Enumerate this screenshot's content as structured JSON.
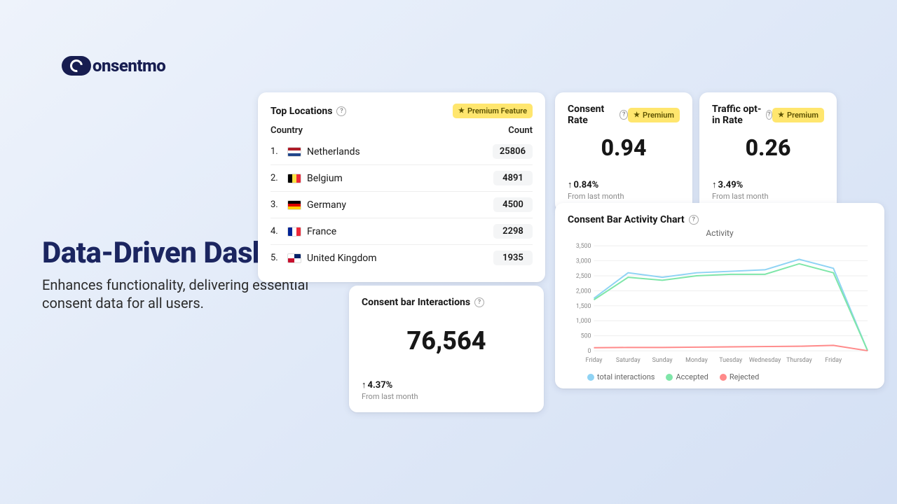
{
  "brand": {
    "name": "onsentmo"
  },
  "hero": {
    "title": "Data-Driven Dashboard",
    "subtitle": "Enhances functionality, delivering essential consent data for all users."
  },
  "badges": {
    "premium_feature": "Premium Feature",
    "premium": "Premium"
  },
  "top_locations": {
    "title": "Top Locations",
    "columns": {
      "country": "Country",
      "count": "Count"
    },
    "rows": [
      {
        "rank": "1.",
        "name": "Netherlands",
        "count": "25806",
        "flag": "nl"
      },
      {
        "rank": "2.",
        "name": "Belgium",
        "count": "4891",
        "flag": "be"
      },
      {
        "rank": "3.",
        "name": "Germany",
        "count": "4500",
        "flag": "de"
      },
      {
        "rank": "4.",
        "name": "France",
        "count": "2298",
        "flag": "fr"
      },
      {
        "rank": "5.",
        "name": "United Kingdom",
        "count": "1935",
        "flag": "gb"
      }
    ]
  },
  "consent_rate": {
    "title": "Consent Rate",
    "value": "0.94",
    "delta": "0.84%",
    "sub": "From last month"
  },
  "optin_rate": {
    "title": "Traffic opt-in Rate",
    "value": "0.26",
    "delta": "3.49%",
    "sub": "From last month"
  },
  "interactions": {
    "title": "Consent bar Interactions",
    "value": "76,564",
    "delta": "4.37%",
    "sub": "From last month"
  },
  "activity": {
    "title": "Consent Bar Activity Chart",
    "chart_title": "Activity",
    "legend": {
      "total": "total interactions",
      "accepted": "Accepted",
      "rejected": "Rejected"
    },
    "colors": {
      "total": "#8fd3f4",
      "accepted": "#7fe6a9",
      "rejected": "#ff8a8a"
    }
  },
  "chart_data": {
    "type": "line",
    "title": "Activity",
    "xlabel": "",
    "ylabel": "",
    "ylim": [
      0,
      3500
    ],
    "y_ticks": [
      0,
      500,
      1000,
      1500,
      2000,
      2500,
      3000,
      3500
    ],
    "categories": [
      "Friday",
      "Saturday",
      "Sunday",
      "Monday",
      "Tuesday",
      "Wednesday",
      "Thursday",
      "Friday"
    ],
    "series": [
      {
        "name": "total interactions",
        "color": "#8fd3f4",
        "values": [
          1750,
          2600,
          2450,
          2600,
          2650,
          2700,
          3050,
          2750,
          0
        ]
      },
      {
        "name": "Accepted",
        "color": "#7fe6a9",
        "values": [
          1700,
          2450,
          2350,
          2500,
          2550,
          2550,
          2900,
          2600,
          0
        ]
      },
      {
        "name": "Rejected",
        "color": "#ff8a8a",
        "values": [
          100,
          110,
          110,
          120,
          130,
          140,
          150,
          180,
          0
        ]
      }
    ]
  }
}
